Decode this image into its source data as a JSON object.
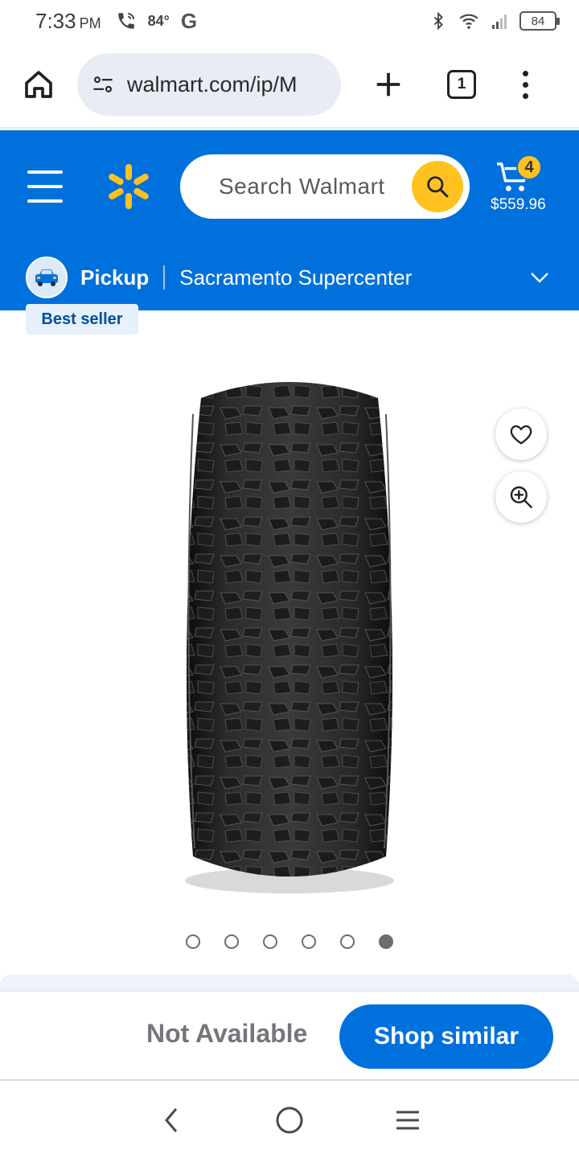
{
  "status_bar": {
    "time": "7:33",
    "ampm": "PM",
    "temperature": "84°",
    "g_label": "G",
    "battery": "84"
  },
  "browser": {
    "url": "walmart.com/ip/M",
    "tab_count": "1"
  },
  "header": {
    "search_placeholder": "Search Walmart",
    "cart_count": "4",
    "cart_total": "$559.96",
    "pickup_label": "Pickup",
    "store_name": "Sacramento Supercenter",
    "brand_color": "#0071dc",
    "accent_color": "#ffc220"
  },
  "product": {
    "badge": "Best seller",
    "image_count": 6,
    "active_image_index": 5
  },
  "actions": {
    "availability": "Not Available",
    "shop_similar_label": "Shop similar"
  },
  "icons": [
    "home-icon",
    "site-settings-icon",
    "plus-icon",
    "tabs-icon",
    "more-icon",
    "hamburger-icon",
    "walmart-spark-icon",
    "search-icon",
    "cart-icon",
    "car-icon",
    "chevron-down-icon",
    "heart-icon",
    "zoom-in-icon",
    "back-icon",
    "home-circle-icon",
    "recents-icon"
  ]
}
